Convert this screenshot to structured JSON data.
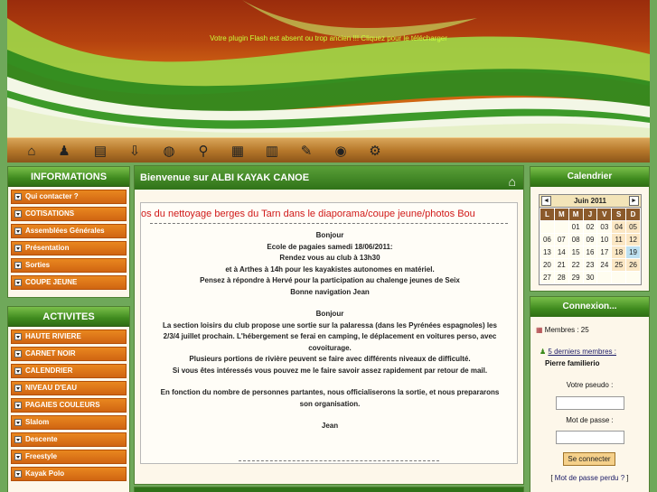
{
  "banner": {
    "flash_message": "Votre plugin Flash est absent ou trop ancien !!! Cliquez pour le télécharger"
  },
  "iconbar": {
    "icons": [
      "home-icon",
      "member-icon",
      "book-icon",
      "download-icon",
      "globe-icon",
      "links-icon",
      "gallery-icon",
      "stats-icon",
      "form-icon",
      "eye-icon",
      "tools-icon"
    ]
  },
  "informations": {
    "title": "INFORMATIONS",
    "items": [
      "Qui contacter ?",
      "COTISATIONS",
      "Assemblées Générales",
      "Présentation",
      "Sorties",
      "COUPE JEUNE"
    ]
  },
  "activites": {
    "title": "ACTIVITES",
    "items": [
      "HAUTE RIVIERE",
      "CARNET NOIR",
      "CALENDRIER",
      "NIVEAU D'EAU",
      "PAGAIES COULEURS",
      "Slalom",
      "Descente",
      "Freestyle",
      "Kayak Polo"
    ]
  },
  "main": {
    "title": "Bienvenue sur ALBI KAYAK CANOE",
    "marquee": "os du nettoyage berges du Tarn dans le diaporama/coupe jeune/photos  Bou",
    "paragraphs": [
      "Bonjour\nEcole de pagaies samedi 18/06/2011:\nRendez vous au club à 13h30\net à Arthes à 14h pour les kayakistes autonomes en matériel.\nPensez à répondre à Hervé pour la participation au chalenge jeunes de Seix\nBonne navigation      Jean",
      "Bonjour\nLa section loisirs du club propose  une sortie sur la palaressa (dans les Pyrénées  espagnoles) les\n2/3/4 juillet prochain. L'hébergement se ferai en camping, le déplacement en voitures perso, avec\ncovoiturage.\nPlusieurs portions de rivière peuvent se faire avec différents niveaux de difficulté.\nSi vous êtes intéressés vous pouvez me le faire savoir assez rapidement par retour de mail.",
      "En fonction du nombre de personnes partantes, nous officialiserons la sortie, et nous prepararons\nson organisation.",
      "Jean"
    ]
  },
  "calendar": {
    "title": "Calendrier",
    "month": "Juin 2011",
    "prev": "◄",
    "next": "►",
    "weekdays": [
      "L",
      "M",
      "M",
      "J",
      "V",
      "S",
      "D"
    ],
    "weeks": [
      [
        "",
        "",
        "01",
        "02",
        "03",
        "04",
        "05"
      ],
      [
        "06",
        "07",
        "08",
        "09",
        "10",
        "11",
        "12"
      ],
      [
        "13",
        "14",
        "15",
        "16",
        "17",
        "18",
        "19"
      ],
      [
        "20",
        "21",
        "22",
        "23",
        "24",
        "25",
        "26"
      ],
      [
        "27",
        "28",
        "29",
        "30",
        "",
        "",
        ""
      ]
    ],
    "today": "19"
  },
  "connexion": {
    "title": "Connexion...",
    "members": "Membres : 25",
    "last_members_link": "5 derniers membres :",
    "last_member": "Pierre   familierio",
    "pseudo_label": "Votre pseudo :",
    "password_label": "Mot de passe :",
    "login_button": "Se connecter",
    "forgot_prefix": "[",
    "forgot_link": "Mot de passe perdu ?",
    "forgot_suffix": "]"
  }
}
